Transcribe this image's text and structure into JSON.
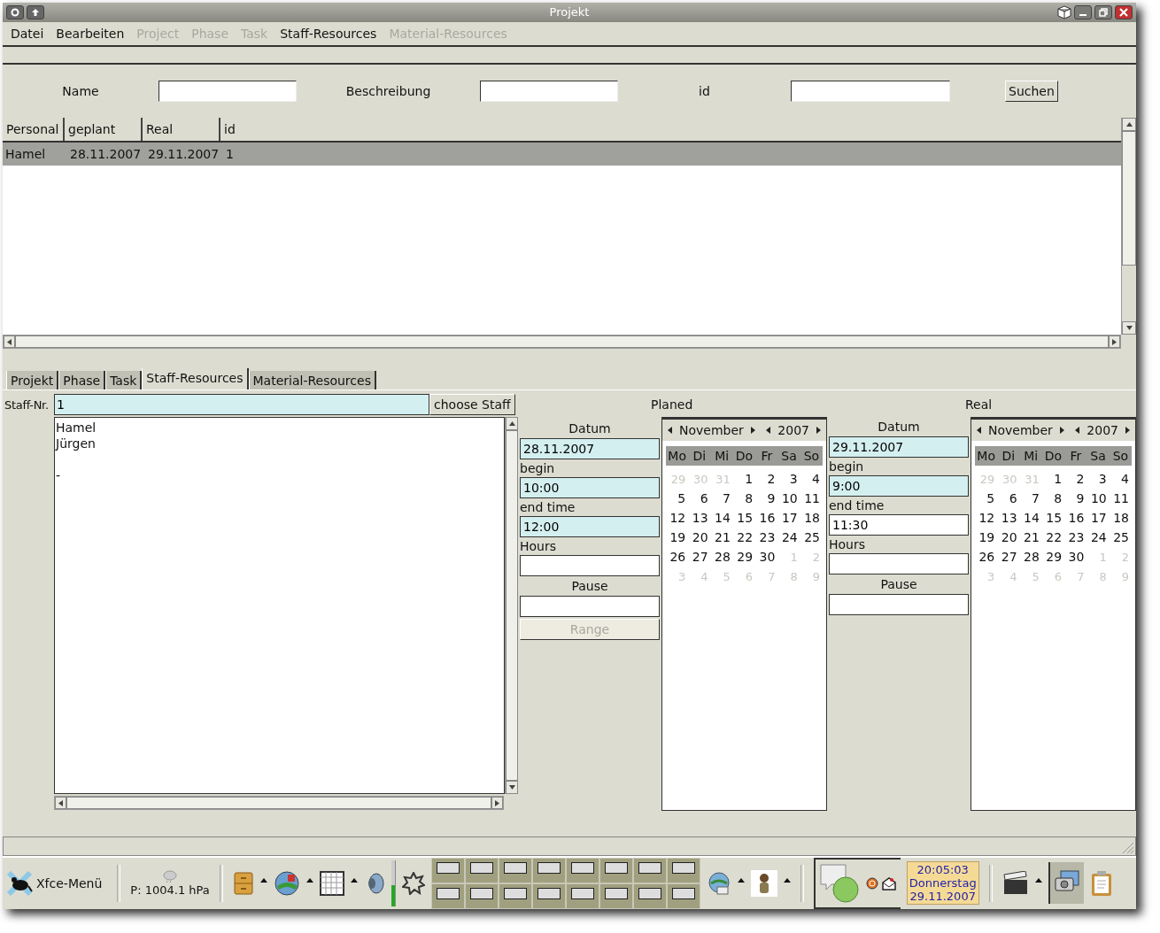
{
  "window": {
    "title": "Projekt"
  },
  "menu": [
    {
      "label": "Datei",
      "disabled": false
    },
    {
      "label": "Bearbeiten",
      "disabled": false
    },
    {
      "label": "Project",
      "disabled": true
    },
    {
      "label": "Phase",
      "disabled": true
    },
    {
      "label": "Task",
      "disabled": true
    },
    {
      "label": "Staff-Resources",
      "disabled": false
    },
    {
      "label": "Material-Resources",
      "disabled": true
    }
  ],
  "search": {
    "fields": [
      {
        "label": "Name"
      },
      {
        "label": "Beschreibung"
      },
      {
        "label": "id"
      }
    ],
    "button": "Suchen"
  },
  "table": {
    "columns": [
      "Personal",
      "geplant",
      "Real",
      "id"
    ],
    "rows": [
      {
        "cells": [
          "Hamel",
          "28.11.2007",
          "29.11.2007",
          "1"
        ],
        "selected": true
      }
    ]
  },
  "tabs": [
    {
      "label": "Projekt",
      "selected": false
    },
    {
      "label": "Phase",
      "selected": false
    },
    {
      "label": "Task",
      "selected": false
    },
    {
      "label": "Staff-Resources",
      "selected": true
    },
    {
      "label": "Material-Resources",
      "selected": false
    }
  ],
  "staff": {
    "label": "Staff-Nr.",
    "value": "1",
    "button": "choose Staff",
    "list": [
      "Hamel",
      "Jürgen",
      "-"
    ]
  },
  "sections": [
    {
      "title": "Planed",
      "fields": [
        {
          "label": "Datum",
          "kind": "header",
          "value": "28.11.2007",
          "highlighted": true
        },
        {
          "label": "begin",
          "kind": "inline",
          "value": "10:00",
          "highlighted": true
        },
        {
          "label": "end time",
          "kind": "inline",
          "value": "12:00",
          "highlighted": true
        },
        {
          "label": "Hours",
          "kind": "inline",
          "highlighted": false
        },
        {
          "label": "Pause",
          "kind": "header",
          "highlighted": false
        }
      ],
      "button": {
        "label": "Range",
        "disabled": true
      },
      "calendar": {
        "month": "November",
        "year": "2007",
        "weekdays": [
          "Mo",
          "Di",
          "Mi",
          "Do",
          "Fr",
          "Sa",
          "So"
        ],
        "weeks": [
          [
            {
              "d": "29",
              "other": true
            },
            {
              "d": "30",
              "other": true
            },
            {
              "d": "31",
              "other": true
            },
            {
              "d": "1",
              "other": false
            },
            {
              "d": "2",
              "other": false
            },
            {
              "d": "3",
              "other": false
            },
            {
              "d": "4",
              "other": false
            }
          ],
          [
            {
              "d": "5",
              "other": false
            },
            {
              "d": "6",
              "other": false
            },
            {
              "d": "7",
              "other": false
            },
            {
              "d": "8",
              "other": false
            },
            {
              "d": "9",
              "other": false
            },
            {
              "d": "10",
              "other": false
            },
            {
              "d": "11",
              "other": false
            }
          ],
          [
            {
              "d": "12",
              "other": false
            },
            {
              "d": "13",
              "other": false
            },
            {
              "d": "14",
              "other": false
            },
            {
              "d": "15",
              "other": false
            },
            {
              "d": "16",
              "other": false
            },
            {
              "d": "17",
              "other": false
            },
            {
              "d": "18",
              "other": false
            }
          ],
          [
            {
              "d": "19",
              "other": false
            },
            {
              "d": "20",
              "other": false
            },
            {
              "d": "21",
              "other": false
            },
            {
              "d": "22",
              "other": false
            },
            {
              "d": "23",
              "other": false
            },
            {
              "d": "24",
              "other": false
            },
            {
              "d": "25",
              "other": false
            }
          ],
          [
            {
              "d": "26",
              "other": false
            },
            {
              "d": "27",
              "other": false
            },
            {
              "d": "28",
              "other": false
            },
            {
              "d": "29",
              "other": false
            },
            {
              "d": "30",
              "other": false
            },
            {
              "d": "1",
              "other": true
            },
            {
              "d": "2",
              "other": true
            }
          ],
          [
            {
              "d": "3",
              "other": true
            },
            {
              "d": "4",
              "other": true
            },
            {
              "d": "5",
              "other": true
            },
            {
              "d": "6",
              "other": true
            },
            {
              "d": "7",
              "other": true
            },
            {
              "d": "8",
              "other": true
            },
            {
              "d": "9",
              "other": true
            }
          ]
        ]
      }
    },
    {
      "title": "Real",
      "fields": [
        {
          "label": "Datum",
          "kind": "header",
          "value": "29.11.2007",
          "highlighted": true
        },
        {
          "label": "begin",
          "kind": "inline",
          "value": "9:00",
          "highlighted": true
        },
        {
          "label": "end time",
          "kind": "inline",
          "value": "11:30",
          "highlighted": false
        },
        {
          "label": "Hours",
          "kind": "inline",
          "highlighted": false
        },
        {
          "label": "Pause",
          "kind": "header",
          "highlighted": false
        }
      ],
      "calendar": {
        "month": "November",
        "year": "2007",
        "weekdays": [
          "Mo",
          "Di",
          "Mi",
          "Do",
          "Fr",
          "Sa",
          "So"
        ],
        "weeks": [
          [
            {
              "d": "29",
              "other": true
            },
            {
              "d": "30",
              "other": true
            },
            {
              "d": "31",
              "other": true
            },
            {
              "d": "1",
              "other": false
            },
            {
              "d": "2",
              "other": false
            },
            {
              "d": "3",
              "other": false
            },
            {
              "d": "4",
              "other": false
            }
          ],
          [
            {
              "d": "5",
              "other": false
            },
            {
              "d": "6",
              "other": false
            },
            {
              "d": "7",
              "other": false
            },
            {
              "d": "8",
              "other": false
            },
            {
              "d": "9",
              "other": false
            },
            {
              "d": "10",
              "other": false
            },
            {
              "d": "11",
              "other": false
            }
          ],
          [
            {
              "d": "12",
              "other": false
            },
            {
              "d": "13",
              "other": false
            },
            {
              "d": "14",
              "other": false
            },
            {
              "d": "15",
              "other": false
            },
            {
              "d": "16",
              "other": false
            },
            {
              "d": "17",
              "other": false
            },
            {
              "d": "18",
              "other": false
            }
          ],
          [
            {
              "d": "19",
              "other": false
            },
            {
              "d": "20",
              "other": false
            },
            {
              "d": "21",
              "other": false
            },
            {
              "d": "22",
              "other": false
            },
            {
              "d": "23",
              "other": false
            },
            {
              "d": "24",
              "other": false
            },
            {
              "d": "25",
              "other": false
            }
          ],
          [
            {
              "d": "26",
              "other": false
            },
            {
              "d": "27",
              "other": false
            },
            {
              "d": "28",
              "other": false
            },
            {
              "d": "29",
              "other": false
            },
            {
              "d": "30",
              "other": false
            },
            {
              "d": "1",
              "other": true
            },
            {
              "d": "2",
              "other": true
            }
          ],
          [
            {
              "d": "3",
              "other": true
            },
            {
              "d": "4",
              "other": true
            },
            {
              "d": "5",
              "other": true
            },
            {
              "d": "6",
              "other": true
            },
            {
              "d": "7",
              "other": true
            },
            {
              "d": "8",
              "other": true
            },
            {
              "d": "9",
              "other": true
            }
          ]
        ]
      }
    }
  ],
  "taskbar": {
    "menu": "Xfce-Menü",
    "weather": "P: 1004.1 hPa",
    "clock": [
      "20:05:03",
      "Donnerstag",
      "29.11.2007"
    ]
  }
}
